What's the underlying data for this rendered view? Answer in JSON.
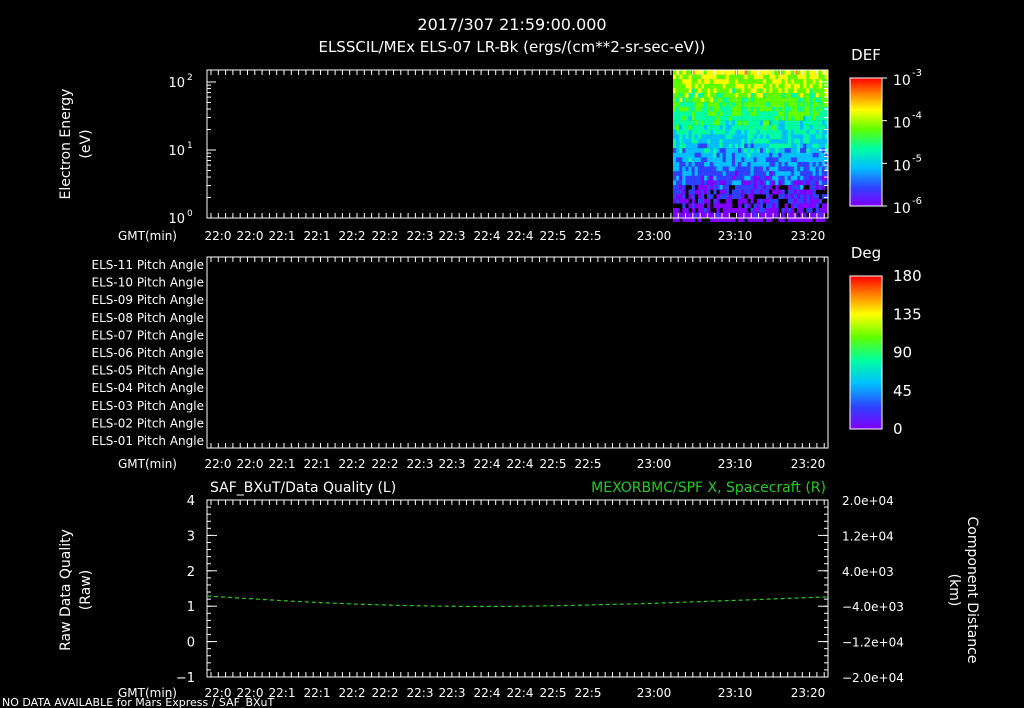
{
  "header": {
    "timestamp": "2017/307 21:59:00.000",
    "title": "ELSSCIL/MEx ELS-07 LR-Bk  (ergs/(cm**2-sr-sec-eV))"
  },
  "footer": {
    "note": "NO DATA AVAILABLE for Mars  Express / SAF_BXuT"
  },
  "time_axis": {
    "label": "GMT(min)",
    "ticks": [
      "22:0",
      "22:0",
      "22:1",
      "22:1",
      "22:2",
      "22:2",
      "22:3",
      "22:3",
      "22:4",
      "22:4",
      "22:5",
      "22:5",
      "23:00",
      "23:10",
      "23:20"
    ]
  },
  "colors": {
    "background": "#000000",
    "axes": "#ffffff",
    "spacecraft_line": "#22cc22"
  },
  "chart_data": [
    {
      "type": "heatmap",
      "panel": "energy_spectrogram",
      "ylabel": [
        "Electron Energy",
        "(eV)"
      ],
      "yscale": "log",
      "ylim": [
        1,
        150
      ],
      "yticks": [
        {
          "base": "10",
          "exp": "0"
        },
        {
          "base": "10",
          "exp": "1"
        },
        {
          "base": "10",
          "exp": "2"
        }
      ],
      "data_coverage": "data present only from about 23:00 to 23:24; earlier interval empty",
      "colorbar": {
        "title": "DEF",
        "scale": "log",
        "range": [
          1e-06,
          0.001
        ],
        "ticks": [
          {
            "base": "10",
            "exp": "-3"
          },
          {
            "base": "10",
            "exp": "-4"
          },
          {
            "base": "10",
            "exp": "-5"
          },
          {
            "base": "10",
            "exp": "-6"
          }
        ]
      },
      "colormap": [
        "#8000ff",
        "#3040ff",
        "#00c0ff",
        "#00ffa0",
        "#60ff00",
        "#ffff00",
        "#ff8000",
        "#ff0000"
      ]
    },
    {
      "type": "heatmap",
      "panel": "pitch_angle",
      "row_labels": [
        "ELS-11 Pitch Angle",
        "ELS-10 Pitch Angle",
        "ELS-09 Pitch Angle",
        "ELS-08 Pitch Angle",
        "ELS-07 Pitch Angle",
        "ELS-06 Pitch Angle",
        "ELS-05 Pitch Angle",
        "ELS-04 Pitch Angle",
        "ELS-03 Pitch Angle",
        "ELS-02 Pitch Angle",
        "ELS-01 Pitch Angle"
      ],
      "data_coverage": "no data shown",
      "colorbar": {
        "title": "Deg",
        "range": [
          0,
          180
        ],
        "ticks": [
          "180",
          "135",
          "90",
          "45",
          "0"
        ]
      }
    },
    {
      "type": "line",
      "panel": "data_quality",
      "left_title": "SAF_BXuT/Data Quality (L)",
      "right_title": "MEXORBMC/SPF X, Spacecraft (R)",
      "ylabel_left": [
        "Raw Data Quality",
        "(Raw)"
      ],
      "ylabel_right": [
        "Component Distance",
        "(km)"
      ],
      "ylim_left": [
        -1,
        4
      ],
      "yticks_left": [
        "4",
        "3",
        "2",
        "1",
        "0",
        "−1"
      ],
      "ylim_right": [
        -20000,
        20000
      ],
      "yticks_right": [
        "2.0e+04",
        "1.2e+04",
        "4.0e+03",
        "−4.0e+03",
        "−1.2e+04",
        "−2.0e+04"
      ],
      "series": [
        {
          "name": "MEXORBMC/SPF X, Spacecraft",
          "axis": "right",
          "style": "dashed",
          "x_min": [
            -1,
            5,
            10,
            15,
            20,
            25,
            30,
            35,
            40,
            45,
            50,
            55,
            60,
            65,
            70,
            75,
            80,
            85
          ],
          "values": [
            -1700,
            -2300,
            -2800,
            -3200,
            -3550,
            -3800,
            -3950,
            -4050,
            -4050,
            -3950,
            -3800,
            -3600,
            -3400,
            -3100,
            -2800,
            -2500,
            -2200,
            -1900
          ]
        }
      ]
    }
  ]
}
